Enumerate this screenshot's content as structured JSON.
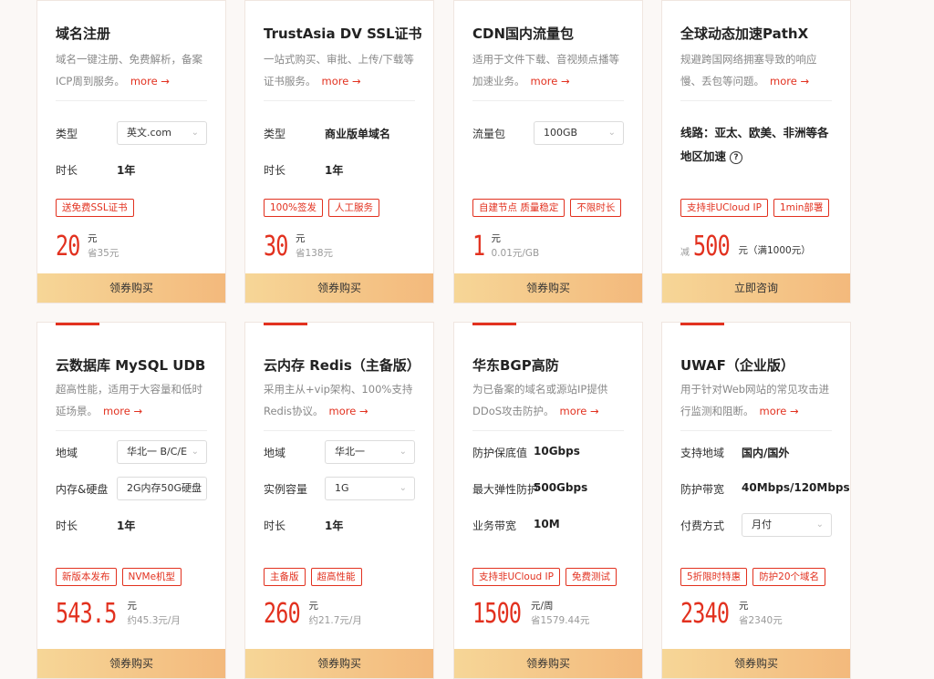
{
  "cards": [
    {
      "title": "域名注册",
      "desc": "域名一键注册、免费解析，备案ICP周到服务。",
      "more": "more →",
      "specs": [
        {
          "label": "类型",
          "select": "英文.com"
        },
        {
          "label": "时长",
          "value": "1年"
        }
      ],
      "tags": [
        "送免费SSL证书"
      ],
      "price": {
        "prefix": "",
        "number": "20",
        "unit": "元",
        "note": "省35元"
      },
      "button": "领券购买"
    },
    {
      "title": "TrustAsia DV SSL证书",
      "desc": "一站式购买、审批、上传/下载等证书服务。",
      "more": "more →",
      "specs": [
        {
          "label": "类型",
          "value": "商业版单域名"
        },
        {
          "label": "时长",
          "value": "1年"
        }
      ],
      "tags": [
        "100%签发",
        "人工服务"
      ],
      "price": {
        "prefix": "",
        "number": "30",
        "unit": "元",
        "note": "省138元"
      },
      "button": "领券购买"
    },
    {
      "title": "CDN国内流量包",
      "desc": "适用于文件下载、音视频点播等加速业务。",
      "more": "more →",
      "specs": [
        {
          "label": "流量包",
          "select": "100GB"
        }
      ],
      "tags": [
        "自建节点 质量稳定",
        "不限时长"
      ],
      "price": {
        "prefix": "",
        "number": "1",
        "unit": "元",
        "note": "0.01元/GB"
      },
      "button": "领券购买"
    },
    {
      "title": "全球动态加速PathX",
      "desc": "规避跨国网络拥塞导致的响应慢、丢包等问题。",
      "more": "more →",
      "specs": [
        {
          "wide": "线路：亚太、欧美、非洲等各地区加速"
        }
      ],
      "tags": [
        "支持非UCloud IP",
        "1min部署"
      ],
      "price": {
        "prefix": "减",
        "number": "500",
        "unit": "",
        "note": "元（满1000元）"
      },
      "button": "立即咨询"
    },
    {
      "title": "云数据库 MySQL UDB",
      "desc": "超高性能，适用于大容量和低时延场景。",
      "more": "more →",
      "specs": [
        {
          "label": "地域",
          "select": "华北一 B/C/E"
        },
        {
          "label": "内存&硬盘",
          "select": "2G内存50G硬盘"
        },
        {
          "label": "时长",
          "value": "1年"
        }
      ],
      "tags": [
        "新版本发布",
        "NVMe机型"
      ],
      "price": {
        "prefix": "",
        "number": "543.5",
        "unit": "元",
        "note": "约45.3元/月"
      },
      "button": "领券购买"
    },
    {
      "title": "云内存 Redis（主备版）",
      "desc": "采用主从+vip架构、100%支持Redis协议。",
      "more": "more →",
      "specs": [
        {
          "label": "地域",
          "select": "华北一"
        },
        {
          "label": "实例容量",
          "select": "1G"
        },
        {
          "label": "时长",
          "value": "1年"
        }
      ],
      "tags": [
        "主备版",
        "超高性能"
      ],
      "price": {
        "prefix": "",
        "number": "260",
        "unit": "元",
        "note": "约21.7元/月"
      },
      "button": "领券购买"
    },
    {
      "title": "华东BGP高防",
      "desc": "为已备案的域名或源站IP提供DDoS攻击防护。",
      "more": "more →",
      "specs": [
        {
          "label": "防护保底值",
          "value": "10Gbps"
        },
        {
          "label": "最大弹性防护",
          "value": "500Gbps"
        },
        {
          "label": "业务带宽",
          "value": "10M"
        }
      ],
      "tags": [
        "支持非UCloud IP",
        "免费测试"
      ],
      "price": {
        "prefix": "",
        "number": "1500",
        "unit": "元/周",
        "note": "省1579.44元"
      },
      "button": "领券购买"
    },
    {
      "title": "UWAF（企业版）",
      "desc": "用于针对Web网站的常见攻击进行监测和阻断。",
      "more": "more →",
      "specs": [
        {
          "label": "支持地域",
          "value": "国内/国外"
        },
        {
          "label": "防护带宽",
          "value": "40Mbps/120Mbps"
        },
        {
          "label": "付费方式",
          "select": "月付"
        }
      ],
      "tags": [
        "5折限时特惠",
        "防护20个域名"
      ],
      "price": {
        "prefix": "",
        "number": "2340",
        "unit": "元",
        "note": "省2340元"
      },
      "button": "领券购买"
    }
  ],
  "icons": {
    "help": "?",
    "chevron": "⌄"
  }
}
